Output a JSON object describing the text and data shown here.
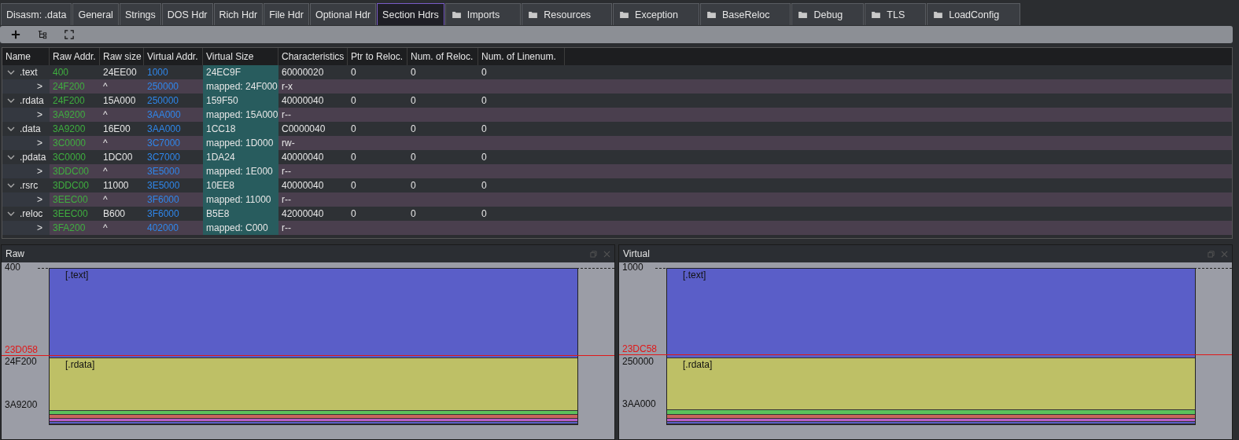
{
  "tabs": [
    {
      "label": "Disasm: .data",
      "selected": false,
      "kind": "plain"
    },
    {
      "label": "General",
      "selected": false,
      "kind": "plain"
    },
    {
      "label": "Strings",
      "selected": false,
      "kind": "plain"
    },
    {
      "label": "DOS Hdr",
      "selected": false,
      "kind": "plain"
    },
    {
      "label": "Rich Hdr",
      "selected": false,
      "kind": "plain"
    },
    {
      "label": "File Hdr",
      "selected": false,
      "kind": "plain"
    },
    {
      "label": "Optional Hdr",
      "selected": false,
      "kind": "plain"
    },
    {
      "label": "Section Hdrs",
      "selected": true,
      "kind": "plain"
    },
    {
      "label": "Imports",
      "selected": false,
      "kind": "folder"
    },
    {
      "label": "Resources",
      "selected": false,
      "kind": "folder"
    },
    {
      "label": "Exception",
      "selected": false,
      "kind": "folder"
    },
    {
      "label": "BaseReloc",
      "selected": false,
      "kind": "folder"
    },
    {
      "label": "Debug",
      "selected": false,
      "kind": "folder"
    },
    {
      "label": "TLS",
      "selected": false,
      "kind": "folder"
    },
    {
      "label": "LoadConfig",
      "selected": false,
      "kind": "folder"
    }
  ],
  "toolbar": [
    {
      "kind": "add"
    },
    {
      "kind": "tree"
    },
    {
      "kind": "fit"
    }
  ],
  "table": {
    "columns": [
      "Name",
      "Raw Addr.",
      "Raw size",
      "Virtual Addr.",
      "Virtual Size",
      "Characteristics",
      "Ptr to Reloc.",
      "Num. of Reloc.",
      "Num. of Linenum."
    ],
    "rows": [
      {
        "name": ".text",
        "raw_addr": "400",
        "raw_size": "24EE00",
        "virtual_addr": "1000",
        "virtual_size": "24EC9F",
        "characteristics": "60000020",
        "ptr_to_reloc": "0",
        "num_reloc": "0",
        "num_linenum": "0",
        "expanded": true,
        "child": {
          "marker": ">",
          "raw_addr": "24F200",
          "raw_size": "^",
          "virtual_addr": "250000",
          "virtual_size": "mapped: 24F000",
          "characteristics": "r-x"
        }
      },
      {
        "name": ".rdata",
        "raw_addr": "24F200",
        "raw_size": "15A000",
        "virtual_addr": "250000",
        "virtual_size": "159F50",
        "characteristics": "40000040",
        "ptr_to_reloc": "0",
        "num_reloc": "0",
        "num_linenum": "0",
        "expanded": true,
        "child": {
          "marker": ">",
          "raw_addr": "3A9200",
          "raw_size": "^",
          "virtual_addr": "3AA000",
          "virtual_size": "mapped: 15A000",
          "characteristics": "r--"
        }
      },
      {
        "name": ".data",
        "raw_addr": "3A9200",
        "raw_size": "16E00",
        "virtual_addr": "3AA000",
        "virtual_size": "1CC18",
        "characteristics": "C0000040",
        "ptr_to_reloc": "0",
        "num_reloc": "0",
        "num_linenum": "0",
        "expanded": true,
        "child": {
          "marker": ">",
          "raw_addr": "3C0000",
          "raw_size": "^",
          "virtual_addr": "3C7000",
          "virtual_size": "mapped: 1D000",
          "characteristics": "rw-"
        }
      },
      {
        "name": ".pdata",
        "raw_addr": "3C0000",
        "raw_size": "1DC00",
        "virtual_addr": "3C7000",
        "virtual_size": "1DA24",
        "characteristics": "40000040",
        "ptr_to_reloc": "0",
        "num_reloc": "0",
        "num_linenum": "0",
        "expanded": true,
        "child": {
          "marker": ">",
          "raw_addr": "3DDC00",
          "raw_size": "^",
          "virtual_addr": "3E5000",
          "virtual_size": "mapped: 1E000",
          "characteristics": "r--"
        }
      },
      {
        "name": ".rsrc",
        "raw_addr": "3DDC00",
        "raw_size": "11000",
        "virtual_addr": "3E5000",
        "virtual_size": "10EE8",
        "characteristics": "40000040",
        "ptr_to_reloc": "0",
        "num_reloc": "0",
        "num_linenum": "0",
        "expanded": true,
        "child": {
          "marker": ">",
          "raw_addr": "3EEC00",
          "raw_size": "^",
          "virtual_addr": "3F6000",
          "virtual_size": "mapped: 11000",
          "characteristics": "r--"
        }
      },
      {
        "name": ".reloc",
        "raw_addr": "3EEC00",
        "raw_size": "B600",
        "virtual_addr": "3F6000",
        "virtual_size": "B5E8",
        "characteristics": "42000040",
        "ptr_to_reloc": "0",
        "num_reloc": "0",
        "num_linenum": "0",
        "expanded": true,
        "child": {
          "marker": ">",
          "raw_addr": "3FA200",
          "raw_size": "^",
          "virtual_addr": "402000",
          "virtual_size": "mapped: C000",
          "characteristics": "r--"
        }
      }
    ]
  },
  "maps": [
    {
      "title": "Raw",
      "kind": "raw",
      "top_label": "400",
      "boundary_label": "24F200",
      "bottom_label": "3A9200",
      "cursor_label": "23D058",
      "sections": [
        {
          "label": "[.text]",
          "color": "#5a5ec8"
        },
        {
          "label": "[.rdata]",
          "color": "#bec066"
        },
        {
          "color": "#5cc05c"
        },
        {
          "color": "#c8645c"
        },
        {
          "color": "#b85cc8"
        },
        {
          "color": "#5a5ec8"
        }
      ]
    },
    {
      "title": "Virtual",
      "kind": "virtual",
      "top_label": "1000",
      "boundary_label": "250000",
      "bottom_label": "3AA000",
      "cursor_label": "23DC58",
      "sections": [
        {
          "label": "[.text]",
          "color": "#5a5ec8"
        },
        {
          "label": "[.rdata]",
          "color": "#bec066"
        },
        {
          "color": "#5cc05c"
        },
        {
          "color": "#c8645c"
        },
        {
          "color": "#b85cc8"
        },
        {
          "color": "#5a5ec8"
        }
      ]
    }
  ]
}
